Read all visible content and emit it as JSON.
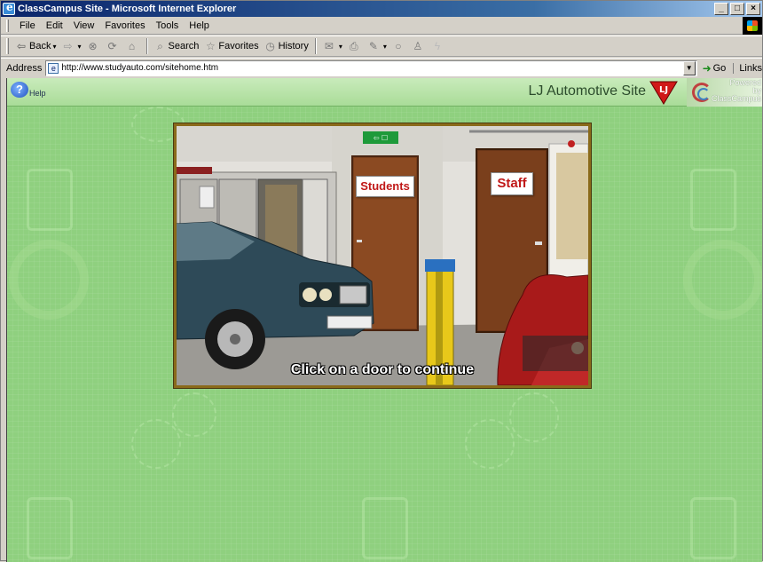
{
  "window": {
    "title": "ClassCampus Site - Microsoft Internet Explorer",
    "controls": [
      "_",
      "□",
      "×"
    ]
  },
  "menu": {
    "items": [
      {
        "label": "File"
      },
      {
        "label": "Edit"
      },
      {
        "label": "View"
      },
      {
        "label": "Favorites"
      },
      {
        "label": "Tools"
      },
      {
        "label": "Help"
      }
    ]
  },
  "toolbar": {
    "back_label": "Back",
    "search_label": "Search",
    "favorites_label": "Favorites",
    "history_label": "History"
  },
  "address": {
    "label": "Address",
    "url": "http://www.studyauto.com/sitehome.htm",
    "go_label": "Go",
    "links_label": "Links"
  },
  "site": {
    "help_label": "Help",
    "title": "LJ Automotive Site",
    "powered_line1": "Powered",
    "powered_line2": "by",
    "powered_line3": "ClassCampus"
  },
  "scene": {
    "students_sign": "Students",
    "staff_sign": "Staff",
    "caption": "Click on a door to continue"
  },
  "colors": {
    "page_bg": "#8fd07f",
    "frame_border": "#8a6a1a",
    "sign_text": "#c01818",
    "title_bar": "#0a246a"
  }
}
